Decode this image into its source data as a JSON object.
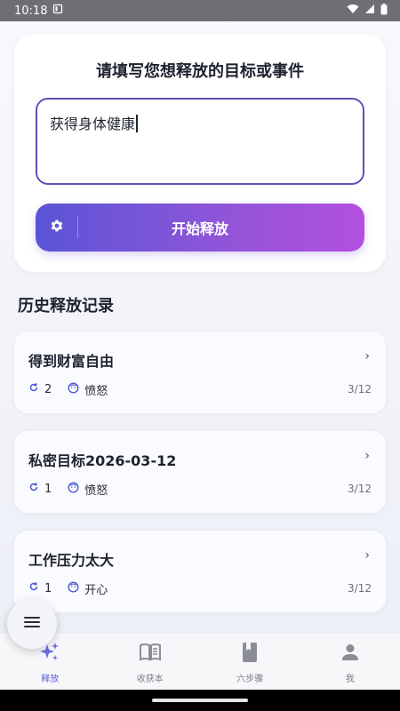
{
  "status_bar": {
    "time": "10:18"
  },
  "input_card": {
    "title": "请填写您想释放的目标或事件",
    "input_value": "获得身体健康",
    "release_button_label": "开始释放"
  },
  "history": {
    "title": "历史释放记录",
    "records": [
      {
        "title": "得到财富自由",
        "count": "2",
        "emotion": "愤怒",
        "date": "3/12"
      },
      {
        "title": "私密目标2026-03-12",
        "count": "1",
        "emotion": "愤怒",
        "date": "3/12"
      },
      {
        "title": "工作压力太大",
        "count": "1",
        "emotion": "开心",
        "date": "3/12"
      }
    ]
  },
  "bottom_nav": {
    "items": [
      {
        "label": "释放",
        "icon": "sparkle-icon",
        "active": true
      },
      {
        "label": "收获本",
        "icon": "book-open-icon",
        "active": false
      },
      {
        "label": "六步骤",
        "icon": "book-icon",
        "active": false
      },
      {
        "label": "我",
        "icon": "person-icon",
        "active": false
      }
    ]
  },
  "colors": {
    "accent": "#5b5fd8",
    "input_border": "#5b52b7",
    "button_gradient_start": "#5955d6",
    "button_gradient_end": "#b350df"
  }
}
